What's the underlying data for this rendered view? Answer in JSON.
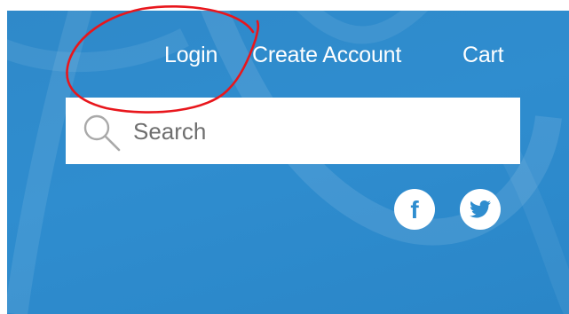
{
  "header": {
    "nav": {
      "login_label": "Login",
      "create_account_label": "Create Account",
      "cart_label": "Cart"
    }
  },
  "search": {
    "placeholder": "Search"
  },
  "social": {
    "facebook_glyph": "f",
    "icons": [
      "facebook-icon",
      "twitter-icon"
    ]
  },
  "colors": {
    "background_blue": "#2f8dcf",
    "text_white": "#ffffff",
    "annotation_red": "#e8161c",
    "social_icon_blue": "#2f8dcf"
  },
  "annotation": {
    "shape": "hand-drawn circle around Login",
    "color": "red"
  }
}
